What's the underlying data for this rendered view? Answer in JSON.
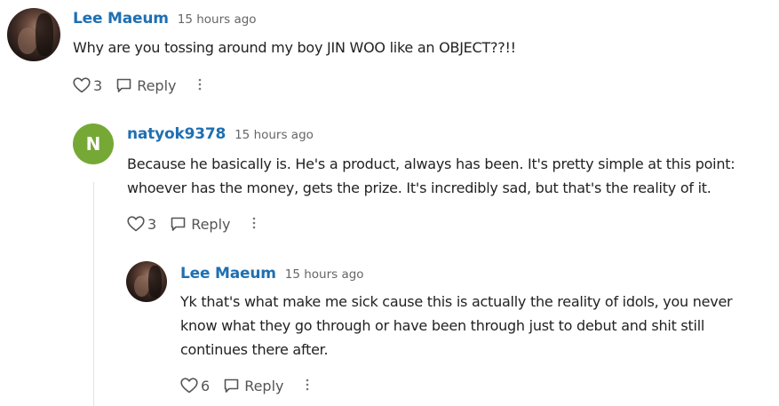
{
  "comments": [
    {
      "author": "Lee Maeum",
      "time": "15 hours ago",
      "text": "Why are you tossing around my boy JIN WOO like an OBJECT??!!",
      "likes": "3",
      "reply_label": "Reply"
    },
    {
      "author": "natyok9378",
      "avatar_letter": "N",
      "time": "15 hours ago",
      "text": "Because he basically is. He's a product, always has been. It's pretty simple at this point: whoever has the money, gets the prize. It's incredibly sad, but that's the reality of it.",
      "likes": "3",
      "reply_label": "Reply"
    },
    {
      "author": "Lee Maeum",
      "time": "15 hours ago",
      "text": "Yk that's what make me sick cause this is actually the reality of idols, you never know what they go through or have been through just to debut and shit still continues there after.",
      "likes": "6",
      "reply_label": "Reply"
    }
  ],
  "colors": {
    "author": "#1f6fb2",
    "letter_avatar_bg": "#76a836",
    "meta_text": "#666666",
    "action_text": "#555555"
  },
  "icons": {
    "like": "heart-outline-icon",
    "reply": "speech-bubble-icon",
    "more": "vertical-dots-icon"
  }
}
